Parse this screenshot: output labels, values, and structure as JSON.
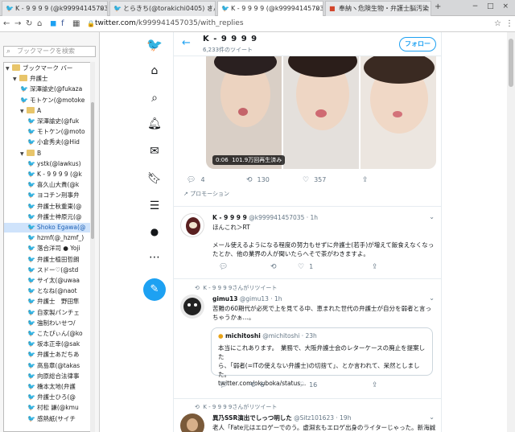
{
  "browser": {
    "tabs": [
      {
        "label": "K - 9 9 9 9 (@k999941457035) さ",
        "active": false
      },
      {
        "label": "とらきち(@torakichi0405) さんの",
        "active": false
      },
      {
        "label": "K - 9 9 9 9 (@k999941457035) さ",
        "active": true
      },
      {
        "label": "奉納ヽ危険生物・弁護士脳汚染",
        "active": false
      }
    ],
    "url_host": "twitter.com",
    "url_path": "/k999941457035/with_replies",
    "accent": "#1da1f2"
  },
  "bookmarks": {
    "search_placeholder": "ブックマークを検索",
    "items": [
      {
        "label": "ブックマーク バー",
        "type": "folder",
        "level": 0,
        "open": true
      },
      {
        "label": "弁護士",
        "type": "folder",
        "level": 1,
        "open": true
      },
      {
        "label": "深澤諭史(@fukaza",
        "type": "link",
        "level": 2
      },
      {
        "label": "モトケン(@motoke",
        "type": "link",
        "level": 2
      },
      {
        "label": "A",
        "type": "folder",
        "level": 2,
        "open": true
      },
      {
        "label": "深澤諭史(@fuk",
        "type": "link",
        "level": 3
      },
      {
        "label": "モトケン(@moto",
        "type": "link",
        "level": 3
      },
      {
        "label": "小倉秀夫(@Hid",
        "type": "link",
        "level": 3
      },
      {
        "label": "B",
        "type": "folder",
        "level": 2,
        "open": true
      },
      {
        "label": "ystk(@lawkus)",
        "type": "link",
        "level": 3
      },
      {
        "label": "K - 9 9 9 9 (@k",
        "type": "link",
        "level": 3
      },
      {
        "label": "喜久山大貴(@k",
        "type": "link",
        "level": 3
      },
      {
        "label": "ヨコチン刑事弁",
        "type": "link",
        "level": 3
      },
      {
        "label": "弁護士秋重東(@",
        "type": "link",
        "level": 3
      },
      {
        "label": "弁護士神原元(@",
        "type": "link",
        "level": 3
      },
      {
        "label": "Shoko Egawa(@",
        "type": "link",
        "level": 3,
        "selected": true
      },
      {
        "label": "hzmf(@_hzmf_)",
        "type": "link",
        "level": 3
      },
      {
        "label": "落合洋司 ● Yoji",
        "type": "link",
        "level": 3
      },
      {
        "label": "弁護士植田哲朗",
        "type": "link",
        "level": 3
      },
      {
        "label": "スドー♡(@std",
        "type": "link",
        "level": 3
      },
      {
        "label": "サイ太(@uwaa",
        "type": "link",
        "level": 3
      },
      {
        "label": "となね(@naot",
        "type": "link",
        "level": 3
      },
      {
        "label": "弁護士　野田隼",
        "type": "link",
        "level": 3
      },
      {
        "label": "自家製パンチェ",
        "type": "link",
        "level": 3
      },
      {
        "label": "強制わいせつ/",
        "type": "link",
        "level": 3
      },
      {
        "label": "こたぴぃん(@ko",
        "type": "link",
        "level": 3
      },
      {
        "label": "坂本正幸(@sak",
        "type": "link",
        "level": 3
      },
      {
        "label": "弁護士あだちあ",
        "type": "link",
        "level": 3
      },
      {
        "label": "高島章(@takas",
        "type": "link",
        "level": 3
      },
      {
        "label": "向原総合法律事",
        "type": "link",
        "level": 3
      },
      {
        "label": "橋本太地(弁護",
        "type": "link",
        "level": 3
      },
      {
        "label": "弁護士ひろ(@",
        "type": "link",
        "level": 3
      },
      {
        "label": "村松 謙(@kmu",
        "type": "link",
        "level": 3
      },
      {
        "label": "感熱紙(サイチ",
        "type": "link",
        "level": 3
      }
    ]
  },
  "profile": {
    "name": "K - 9 9 9 9",
    "tweet_count": "6,233件のツイート",
    "follow_label": "フォロー"
  },
  "media_tweet": {
    "duration": "0:06",
    "views": "101.9万回再生済み",
    "replies": "4",
    "retweets": "130",
    "likes": "357",
    "promotion": "プロモーション"
  },
  "tweets": [
    {
      "name": "K - 9 9 9 9",
      "handle": "@k999941457035 · 1h",
      "lines": [
        "ほんこれ＞RT",
        "",
        "メール使えるようになる程度の努力もせずに弁護士(若手)が増えて飯食えなくなっ",
        "たとか、他の業界の人が聞いたらへそで茶がわきますよ。"
      ],
      "replies": "",
      "retweets": "",
      "likes": "1"
    },
    {
      "retweeted_by": "K - 9 9 9 9さんがリツイート",
      "name": "gimu13",
      "handle": "@gimu13 · 1h",
      "lines": [
        "苦難の60期代が必死で上を見てる中、恵まれた世代の弁護士が自分を弱者と言っ",
        "ちゃうかぁ…。"
      ],
      "quote": {
        "name": "michitoshi",
        "handle": "@michitoshi · 23h",
        "lines": [
          "本当にこれあります。　業務で、大阪弁護士会のレターケースの廃止を提案した",
          "ら、「弱者(=ITの使えない弁護士)の切捨て」、とか言われて、呆然としました。"
        ],
        "link": "twitter.com/okuboka/status..."
      },
      "replies": "",
      "retweets": "6",
      "likes": "16"
    },
    {
      "retweeted_by": "K - 9 9 9 9さんがリツイート",
      "name": "異乃SSR演出でしっつ明した",
      "handle": "@Sitz101623 · 19h",
      "lines": [
        "老人「Fate元はエロゲーでのう。虚淵玄もエロゲ出身のライターじゃった。新海誠は"
      ]
    }
  ]
}
